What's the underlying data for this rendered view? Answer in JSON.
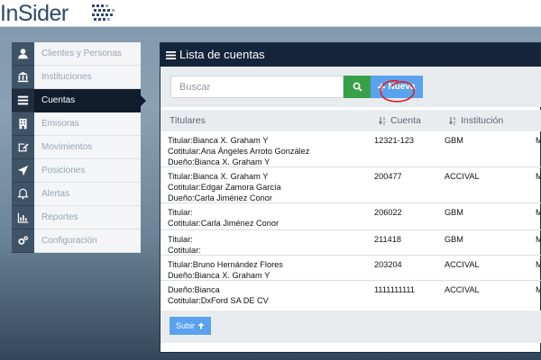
{
  "app": {
    "logo_text": "InSider"
  },
  "sidebar": {
    "items": [
      {
        "label": "Clientes y Personas",
        "icon": "user-icon"
      },
      {
        "label": "Instituciones",
        "icon": "bank-icon"
      },
      {
        "label": "Cuentas",
        "icon": "list-icon",
        "active": true
      },
      {
        "label": "Emisoras",
        "icon": "building-icon"
      },
      {
        "label": "Movimientos",
        "icon": "edit-icon"
      },
      {
        "label": "Posiciones",
        "icon": "location-arrow-icon"
      },
      {
        "label": "Alertas",
        "icon": "bell-icon"
      },
      {
        "label": "Reportes",
        "icon": "bar-chart-icon"
      },
      {
        "label": "Configuración",
        "icon": "gears-icon"
      }
    ]
  },
  "main": {
    "title": "Lista de cuentas",
    "search": {
      "placeholder": "Buscar",
      "value": ""
    },
    "new_label": "Nueva",
    "upload_label": "Subir",
    "columns": [
      "Titulares",
      "Cuenta",
      "Institución"
    ],
    "rows": [
      {
        "titulares": [
          "Titular:Bianca X. Graham Y",
          "Cotitular:Ana Ángeles Arroto González",
          "Dueño:Bianca X. Graham Y"
        ],
        "cuenta": "12321-123",
        "institucion": "GBM",
        "extra": "M"
      },
      {
        "titulares": [
          "Titular:Bianca X. Graham Y",
          "Cotitular:Edgar Zamora García",
          "Dueño:Carla Jiménez Conor"
        ],
        "cuenta": "200477",
        "institucion": "ACCIVAL",
        "extra": "M"
      },
      {
        "titulares": [
          "Titular:",
          "Cotitular:Carla Jiménez Conor"
        ],
        "cuenta": "206022",
        "institucion": "GBM",
        "extra": "M"
      },
      {
        "titulares": [
          "Titular:",
          "Cotitular:"
        ],
        "cuenta": "211418",
        "institucion": "GBM",
        "extra": "M"
      },
      {
        "titulares": [
          "Titular:Bruno Hernández Flores",
          "Dueño:Bianca X. Graham Y"
        ],
        "cuenta": "203204",
        "institucion": "ACCIVAL",
        "extra": "M"
      },
      {
        "titulares": [
          "Dueño:Bianca",
          "Cotitular:DxFord SA DE CV"
        ],
        "cuenta": "1111111111",
        "institucion": "ACCIVAL",
        "extra": "M"
      }
    ]
  },
  "colors": {
    "header_bg": "#14243a",
    "active_nav": "#0f1c2c",
    "accent_blue": "#5aa2ee",
    "search_green": "#37a14a",
    "annotation_red": "#e02020"
  }
}
